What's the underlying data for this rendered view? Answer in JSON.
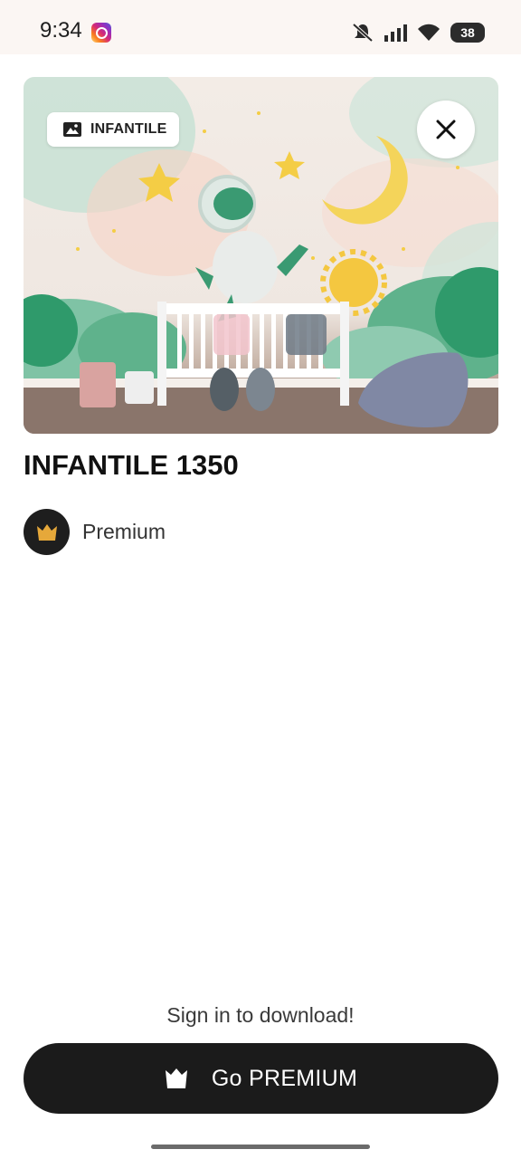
{
  "status_bar": {
    "time": "9:34",
    "battery": "38",
    "icons": [
      "instagram-icon",
      "mute-icon",
      "signal-icon",
      "wifi-icon",
      "battery-icon"
    ]
  },
  "hero": {
    "category_chip": "INFANTILE",
    "chip_icon": "image-icon",
    "close_icon": "close-icon"
  },
  "product": {
    "title": "INFANTILE 1350",
    "tier_icon": "crown-icon",
    "tier_label": "Premium"
  },
  "footer": {
    "signin_text": "Sign in to download!",
    "cta_label": "Go PREMIUM",
    "cta_icon": "crown-icon"
  },
  "colors": {
    "accent_dark": "#1b1b1b",
    "crown_gold": "#e6a83a"
  }
}
